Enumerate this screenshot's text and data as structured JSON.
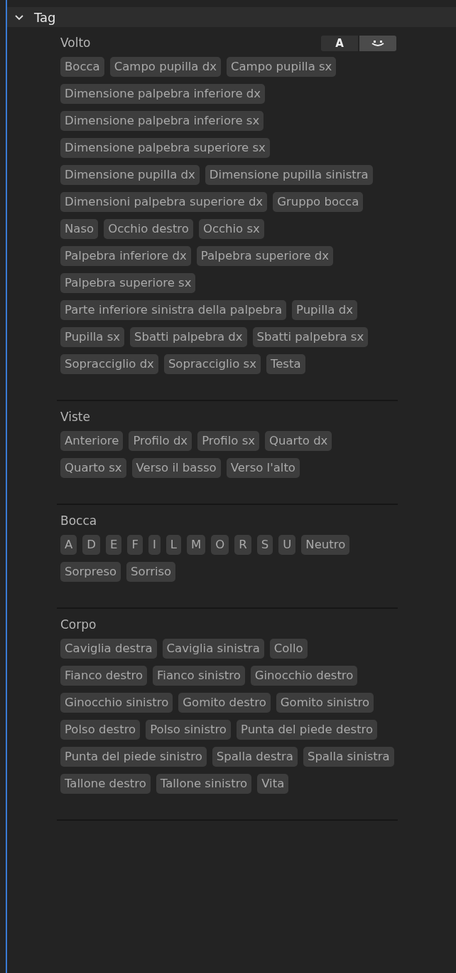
{
  "panel": {
    "title": "Tag",
    "expanded": true
  },
  "sections": [
    {
      "title": "Volto",
      "toggle": [
        {
          "kind": "letter",
          "label": "A",
          "selected": false
        },
        {
          "kind": "face",
          "selected": true
        }
      ],
      "tags": [
        "Bocca",
        "Campo pupilla dx",
        "Campo pupilla sx",
        "Dimensione palpebra inferiore dx",
        "Dimensione palpebra inferiore sx",
        "Dimensione palpebra superiore sx",
        "Dimensione pupilla dx",
        "Dimensione pupilla sinistra",
        "Dimensioni palpebra superiore dx",
        "Gruppo bocca",
        "Naso",
        "Occhio destro",
        "Occhio sx",
        "Palpebra inferiore dx",
        "Palpebra superiore dx",
        "Palpebra superiore sx",
        "Parte inferiore sinistra della palpebra",
        "Pupilla dx",
        "Pupilla sx",
        "Sbatti palpebra dx",
        "Sbatti palpebra sx",
        "Sopracciglio dx",
        "Sopracciglio sx",
        "Testa"
      ]
    },
    {
      "title": "Viste",
      "tags": [
        "Anteriore",
        "Profilo dx",
        "Profilo sx",
        "Quarto dx",
        "Quarto sx",
        "Verso il basso",
        "Verso l'alto"
      ]
    },
    {
      "title": "Bocca",
      "tags": [
        "A",
        "D",
        "E",
        "F",
        "I",
        "L",
        "M",
        "O",
        "R",
        "S",
        "U",
        "Neutro",
        "Sorpreso",
        "Sorriso"
      ]
    },
    {
      "title": "Corpo",
      "tags": [
        "Caviglia destra",
        "Caviglia sinistra",
        "Collo",
        "Fianco destro",
        "Fianco sinistro",
        "Ginocchio destro",
        "Ginocchio sinistro",
        "Gomito destro",
        "Gomito sinistro",
        "Polso destro",
        "Polso sinistro",
        "Punta del piede destro",
        "Punta del piede sinistro",
        "Spalla destra",
        "Spalla sinistra",
        "Tallone destro",
        "Tallone sinistro",
        "Vita"
      ]
    }
  ]
}
